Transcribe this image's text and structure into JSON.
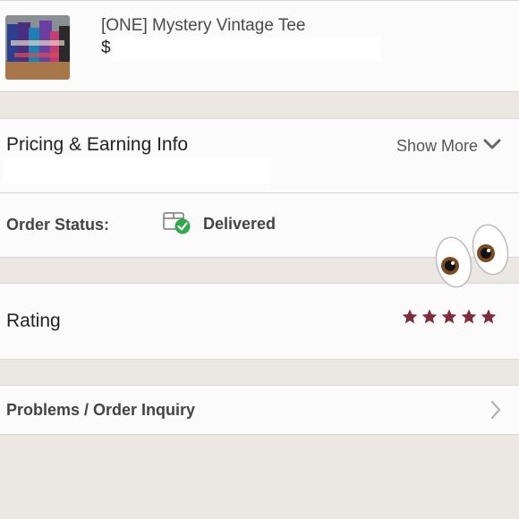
{
  "product": {
    "title": "[ONE] Mystery Vintage Tee",
    "price_symbol": "$"
  },
  "pricing": {
    "title": "Pricing & Earning Info",
    "show_more_label": "Show More"
  },
  "order_status": {
    "label": "Order Status:",
    "value": "Delivered"
  },
  "rating": {
    "label": "Rating",
    "stars": 5,
    "max_stars": 5,
    "star_color": "#7e2b3a"
  },
  "problems": {
    "label": "Problems / Order Inquiry"
  },
  "colors": {
    "background": "#ebe8e3",
    "panel": "#fcfbfb",
    "success": "#2faa4a",
    "accent": "#7e2b3a"
  },
  "icons": {
    "status": "package-check-icon",
    "show_more": "chevron-down-icon",
    "problems": "chevron-right-icon",
    "overlay": "eyes-emoji"
  }
}
